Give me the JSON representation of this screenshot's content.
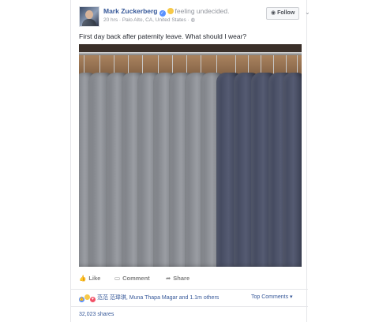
{
  "post": {
    "author": "Mark Zuckerberg",
    "feeling": "feeling undecided.",
    "meta": "20 hrs · Palo Alto, CA, United States · ◍",
    "follow_label": "Follow",
    "text": "First day back after paternity leave. What should I wear?"
  },
  "actions": {
    "like": "Like",
    "comment": "Comment",
    "share": "Share"
  },
  "reactions": {
    "summary": "范范 范瑋琪, Muna Thapa Magar and 1.1m others",
    "top_comments": "Top Comments ▾"
  },
  "shares": "32,023 shares",
  "icons": {
    "verified": "verified-badge-icon",
    "feeling": "undecided-emoji-icon",
    "follow": "rss-icon",
    "more": "chevron-down-icon",
    "like": "thumbs-up-icon",
    "comment": "speech-bubble-icon",
    "share": "share-arrow-icon"
  },
  "colors": {
    "link": "#365899",
    "like_reaction": "#5890ff",
    "haha_reaction": "#f7c948",
    "love_reaction": "#f25268"
  }
}
